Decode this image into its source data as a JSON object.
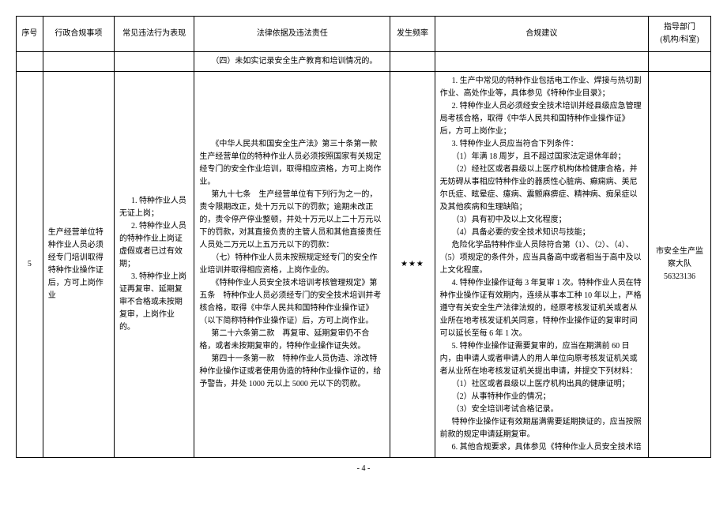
{
  "headers": {
    "seq": "序号",
    "matter": "行政合规事项",
    "violation": "常见违法行为表现",
    "basis": "法律依据及违法责任",
    "freq": "发生频率",
    "advice": "合规建议",
    "dept": "指导部门\n(机构/科室)"
  },
  "prevRow": {
    "basis": "（四）未如实记录安全生产教育和培训情况的。"
  },
  "row5": {
    "seq": "5",
    "matter": "生产经营单位特种作业人员必须经专门培训取得特种作业操作证后，方可上岗作业",
    "violation_p1": "1. 特种作业人员无证上岗；",
    "violation_p2": "2. 特种作业人员的特种作业上岗证虚假或者已过有效期；",
    "violation_p3": "3. 特种作业上岗证再复审、延期复审不合格或未按期复审，上岗作业的。",
    "basis_p1": "《中华人民共和国安全生产法》第三十条第一款 生产经营单位的特种作业人员必须按照国家有关规定经专门的安全作业培训，取得相应资格，方可上岗作业。",
    "basis_p2": "第九十七条　生产经营单位有下列行为之一的，责令限期改正，处十万元以下的罚款；逾期未改正的，责令停产停业整顿，并处十万元以上二十万元以下的罚款，对其直接负责的主管人员和其他直接责任人员处二万元以上五万元以下的罚款：",
    "basis_p3": "（七）特种作业人员未按照规定经专门的安全作业培训并取得相应资格，上岗作业的。",
    "basis_p4": "《特种作业人员安全技术培训考核管理规定》第五条　特种作业人员必须经专门的安全技术培训并考核合格，取得《中华人民共和国特种作业操作证》（以下简称特种作业操作证）后，方可上岗作业。",
    "basis_p5": "第二十六条第二款　再复审、延期复审仍不合格，或者未按期复审的，特种作业操作证失效。",
    "basis_p6": "第四十一条第一款　特种作业人员伪造、涂改特种作业操作证或者使用伪造的特种作业操作证的，给予警告，并处 1000 元以上 5000 元以下的罚款。",
    "freq": "★★★",
    "advice_p1": "1. 生产中常见的特种作业包括电工作业、焊接与热切割作业、高处作业等，具体参见《特种作业目录》；",
    "advice_p2": "2. 特种作业人员必须经安全技术培训并经县级应急管理局考核合格，取得《中华人民共和国特种作业操作证》后，方可上岗作业；",
    "advice_p3": "3. 特种作业人员应当符合下列条件：",
    "advice_p4": "（1）年满 18 周岁，且不超过国家法定退休年龄；",
    "advice_p5": "（2）经社区或者县级以上医疗机构体检健康合格，并无妨碍从事相应特种作业的器质性心脏病、癫痫病、美尼尔氏症、眩晕症、癔病、震颤麻痹症、精神病、痴呆症以及其他疾病和生理缺陷；",
    "advice_p6": "（3）具有初中及以上文化程度；",
    "advice_p7": "（4）具备必要的安全技术知识与技能；",
    "advice_p8": "危险化学品特种作业人员除符合第（1）、（2）、（4）、（5）项规定的条件外，应当具备高中或者相当于高中及以上文化程度。",
    "advice_p9": "4. 特种作业操作证每 3 年复审 1 次。特种作业人员在特种作业操作证有效期内，连续从事本工种 10 年以上，严格遵守有关安全生产法律法规的，经原考核发证机关或者从业所在地考核发证机关同意，特种作业操作证的复审时间可以延长至每 6 年 1 次。",
    "advice_p10": "5. 特种作业操作证需要复审的，应当在期满前 60 日内，由申请人或者申请人的用人单位向原考核发证机关或者从业所在地考核发证机关提出申请，并提交下列材料：",
    "advice_p11": "（1）社区或者县级以上医疗机构出具的健康证明；",
    "advice_p12": "（2）从事特种作业的情况；",
    "advice_p13": "（3）安全培训考试合格记录。",
    "advice_p14": "特种作业操作证有效期届满需要延期换证的，应当按照前款的规定申请延期复审。",
    "advice_p15": "6. 其他合规要求，具体参见《特种作业人员安全技术培",
    "dept_line1": "市安全生产监察大队",
    "dept_line2": "56323136"
  },
  "pageNum": "- 4 -"
}
